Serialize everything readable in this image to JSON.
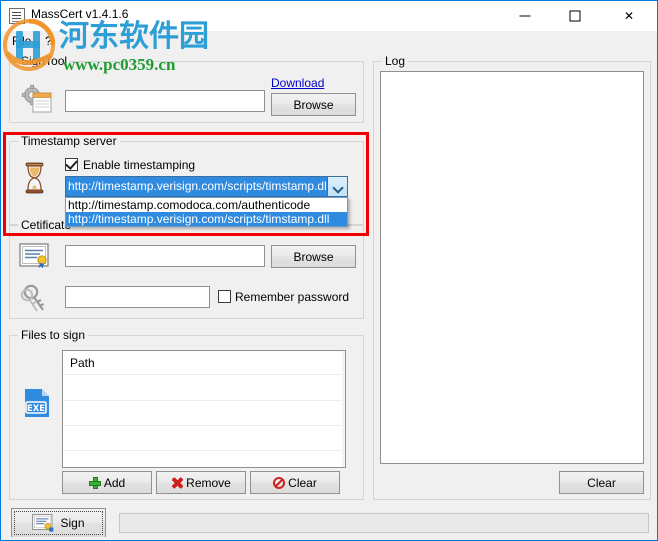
{
  "window": {
    "title": "MassCert v1.4.1.6",
    "icon": "app-document-icon",
    "controls": {
      "minimize": "minimize",
      "maximize": "maximize",
      "close": "close"
    }
  },
  "menu": {
    "items": [
      {
        "label": "File"
      },
      {
        "label": "?"
      }
    ]
  },
  "watermark": {
    "site_name_cn": "河东软件园",
    "site_url": "www.pc0359.cn",
    "cn_color": "#2e9fd6",
    "url_color": "#1f9c2f"
  },
  "signtool": {
    "group_label": "SignTool",
    "icon": "gear-document-icon",
    "path_value": "",
    "path_placeholder": "",
    "download_link": "Download",
    "browse_label": "Browse"
  },
  "timestamp": {
    "group_label": "Timestamp server",
    "icon": "hourglass-icon",
    "enable_label": "Enable timestamping",
    "enabled": true,
    "selected_value": "http://timestamp.verisign.com/scripts/timstamp.dll",
    "dropdown_open": true,
    "options": [
      {
        "label": "http://timestamp.comodoca.com/authenticode",
        "selected": false
      },
      {
        "label": "http://timestamp.verisign.com/scripts/timstamp.dll",
        "selected": true
      }
    ],
    "highlight_color": "#f00000"
  },
  "certificate": {
    "group_label": "Cetificate",
    "cert_icon": "certificate-icon",
    "key_icon": "keys-icon",
    "cert_path_value": "",
    "browse_label": "Browse",
    "password_value": "",
    "remember_label": "Remember password",
    "remember_checked": false
  },
  "files": {
    "group_label": "Files to sign",
    "icon": "exe-file-icon",
    "column_header": "Path",
    "rows": [],
    "buttons": {
      "add": "Add",
      "remove": "Remove",
      "clear": "Clear"
    }
  },
  "log": {
    "group_label": "Log",
    "content": "",
    "clear_label": "Clear"
  },
  "bottom": {
    "sign_label": "Sign",
    "sign_icon": "certificate-sign-icon",
    "progress_value": 0
  }
}
